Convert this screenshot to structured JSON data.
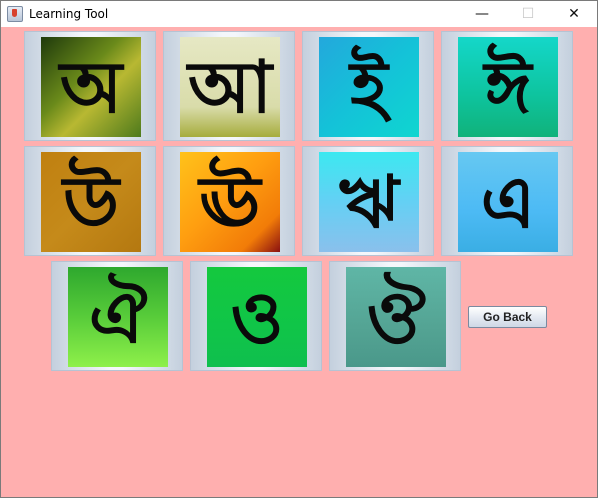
{
  "window": {
    "title": "Learning Tool",
    "controls": {
      "minimize": "—",
      "maximize": "☐",
      "close": "✕"
    }
  },
  "tiles": [
    {
      "letter": "অ",
      "background": "linear-gradient(135deg,#1f3a0c 0%,#6a8a1a 40%,#b8b832 60%,#4e7a1c 100%)"
    },
    {
      "letter": "আ",
      "background": "linear-gradient(180deg,#e6e8c4 0%,#d9dcaa 70%,#a6ac3c 100%)"
    },
    {
      "letter": "ই",
      "background": "linear-gradient(135deg,#23a8dc 0%,#14c2d8 50%,#0fd6d0 100%)"
    },
    {
      "letter": "ঈ",
      "background": "linear-gradient(180deg,#14d7c9 0%,#0ec39d 60%,#10b27a 100%)"
    },
    {
      "letter": "উ",
      "background": "linear-gradient(135deg,#c08010 0%,#c58a1a 50%,#b47810 100%)"
    },
    {
      "letter": "ঊ",
      "background": "linear-gradient(135deg,#ffc21a 0%,#ff9e10 45%,#f27c08 80%,#8a1010 100%)"
    },
    {
      "letter": "ঋ",
      "background": "linear-gradient(180deg,#3ce8f0 0%,#64d0f4 50%,#8ac0ec 100%)"
    },
    {
      "letter": "এ",
      "background": "linear-gradient(180deg,#66c8f2 0%,#4cbaf4 60%,#3aaee4 100%)"
    },
    {
      "letter": "ঐ",
      "background": "linear-gradient(180deg,#2ea82e 0%,#58cc3a 50%,#8ef04a 100%)"
    },
    {
      "letter": "ও",
      "background": "linear-gradient(180deg,#14c83e 0%,#10c548 60%,#0fbf4e 100%)"
    },
    {
      "letter": "ঔ",
      "background": "linear-gradient(180deg,#5fb6a6 0%,#54a494 60%,#4a988a 100%)"
    }
  ],
  "go_back_label": "Go Back"
}
